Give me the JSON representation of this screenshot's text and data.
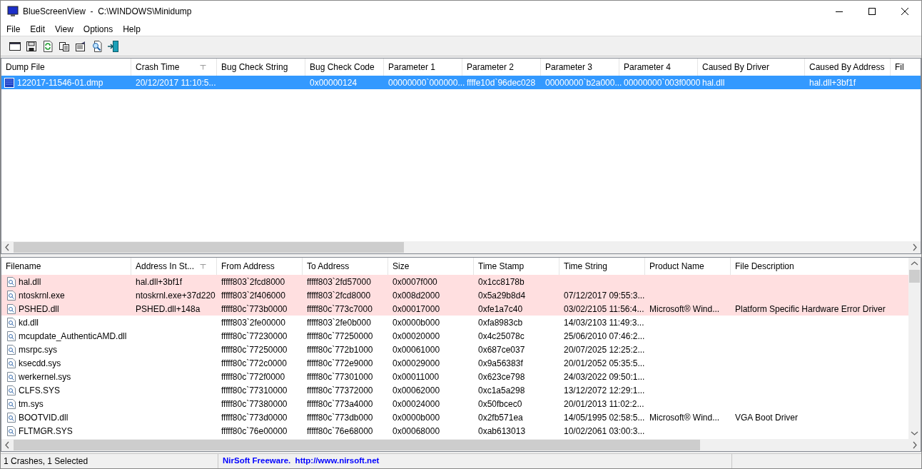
{
  "window": {
    "title": "BlueScreenView  -  C:\\WINDOWS\\Minidump"
  },
  "menu": [
    "File",
    "Edit",
    "View",
    "Options",
    "Help"
  ],
  "crash_list": {
    "columns": [
      {
        "label": "Dump File",
        "sorted": false
      },
      {
        "label": "Crash Time",
        "sorted": true
      },
      {
        "label": "Bug Check String",
        "sorted": false
      },
      {
        "label": "Bug Check Code",
        "sorted": false
      },
      {
        "label": "Parameter 1",
        "sorted": false
      },
      {
        "label": "Parameter 2",
        "sorted": false
      },
      {
        "label": "Parameter 3",
        "sorted": false
      },
      {
        "label": "Parameter 4",
        "sorted": false
      },
      {
        "label": "Caused By Driver",
        "sorted": false
      },
      {
        "label": "Caused By Address",
        "sorted": false
      },
      {
        "label": "Fil",
        "sorted": false
      }
    ],
    "rows": [
      {
        "selected": true,
        "cells": [
          "122017-11546-01.dmp",
          "20/12/2017 11:10:5...",
          "",
          "0x00000124",
          "00000000`000000...",
          "ffffe10d`96dec028",
          "00000000`b2a000...",
          "00000000`003f0000",
          "hal.dll",
          "hal.dll+3bf1f",
          ""
        ]
      }
    ]
  },
  "driver_list": {
    "columns": [
      {
        "label": "Filename",
        "sorted": false
      },
      {
        "label": "Address In St...",
        "sorted": true
      },
      {
        "label": "From Address",
        "sorted": false
      },
      {
        "label": "To Address",
        "sorted": false
      },
      {
        "label": "Size",
        "sorted": false
      },
      {
        "label": "Time Stamp",
        "sorted": false
      },
      {
        "label": "Time String",
        "sorted": false
      },
      {
        "label": "Product Name",
        "sorted": false
      },
      {
        "label": "File Description",
        "sorted": false
      }
    ],
    "rows": [
      {
        "highlighted": true,
        "cells": [
          "hal.dll",
          "hal.dll+3bf1f",
          "fffff803`2fcd8000",
          "fffff803`2fd57000",
          "0x0007f000",
          "0x1cc8178b",
          "",
          "",
          ""
        ]
      },
      {
        "highlighted": true,
        "cells": [
          "ntoskrnl.exe",
          "ntoskrnl.exe+37d220",
          "fffff803`2f406000",
          "fffff803`2fcd8000",
          "0x008d2000",
          "0x5a29b8d4",
          "07/12/2017 09:55:3...",
          "",
          ""
        ]
      },
      {
        "highlighted": true,
        "cells": [
          "PSHED.dll",
          "PSHED.dll+148a",
          "fffff80c`773b0000",
          "fffff80c`773c7000",
          "0x00017000",
          "0xfe1a7c40",
          "03/02/2105 11:56:4...",
          "Microsoft® Wind...",
          "Platform Specific Hardware Error Driver"
        ]
      },
      {
        "highlighted": false,
        "cells": [
          "kd.dll",
          "",
          "fffff803`2fe00000",
          "fffff803`2fe0b000",
          "0x0000b000",
          "0xfa8983cb",
          "14/03/2103 11:49:3...",
          "",
          ""
        ]
      },
      {
        "highlighted": false,
        "cells": [
          "mcupdate_AuthenticAMD.dll",
          "",
          "fffff80c`77230000",
          "fffff80c`77250000",
          "0x00020000",
          "0x4c25078c",
          "25/06/2010 07:46:2...",
          "",
          ""
        ]
      },
      {
        "highlighted": false,
        "cells": [
          "msrpc.sys",
          "",
          "fffff80c`77250000",
          "fffff80c`772b1000",
          "0x00061000",
          "0x687ce037",
          "20/07/2025 12:25:2...",
          "",
          ""
        ]
      },
      {
        "highlighted": false,
        "cells": [
          "ksecdd.sys",
          "",
          "fffff80c`772c0000",
          "fffff80c`772e9000",
          "0x00029000",
          "0x9a56383f",
          "20/01/2052 05:35:5...",
          "",
          ""
        ]
      },
      {
        "highlighted": false,
        "cells": [
          "werkernel.sys",
          "",
          "fffff80c`772f0000",
          "fffff80c`77301000",
          "0x00011000",
          "0x623ce798",
          "24/03/2022 09:50:1...",
          "",
          ""
        ]
      },
      {
        "highlighted": false,
        "cells": [
          "CLFS.SYS",
          "",
          "fffff80c`77310000",
          "fffff80c`77372000",
          "0x00062000",
          "0xc1a5a298",
          "13/12/2072 12:29:1...",
          "",
          ""
        ]
      },
      {
        "highlighted": false,
        "cells": [
          "tm.sys",
          "",
          "fffff80c`77380000",
          "fffff80c`773a4000",
          "0x00024000",
          "0x50fbcec0",
          "20/01/2013 11:02:2...",
          "",
          ""
        ]
      },
      {
        "highlighted": false,
        "cells": [
          "BOOTVID.dll",
          "",
          "fffff80c`773d0000",
          "fffff80c`773db000",
          "0x0000b000",
          "0x2fb571ea",
          "14/05/1995 02:58:5...",
          "Microsoft® Wind...",
          "VGA Boot Driver"
        ]
      },
      {
        "highlighted": false,
        "cells": [
          "FLTMGR.SYS",
          "",
          "fffff80c`76e00000",
          "fffff80c`76e68000",
          "0x00068000",
          "0xab613013",
          "10/02/2061 03:00:3...",
          "",
          ""
        ]
      }
    ]
  },
  "status_bar": {
    "summary": "1 Crashes, 1 Selected",
    "link": "NirSoft Freeware.  http://www.nirsoft.net"
  }
}
